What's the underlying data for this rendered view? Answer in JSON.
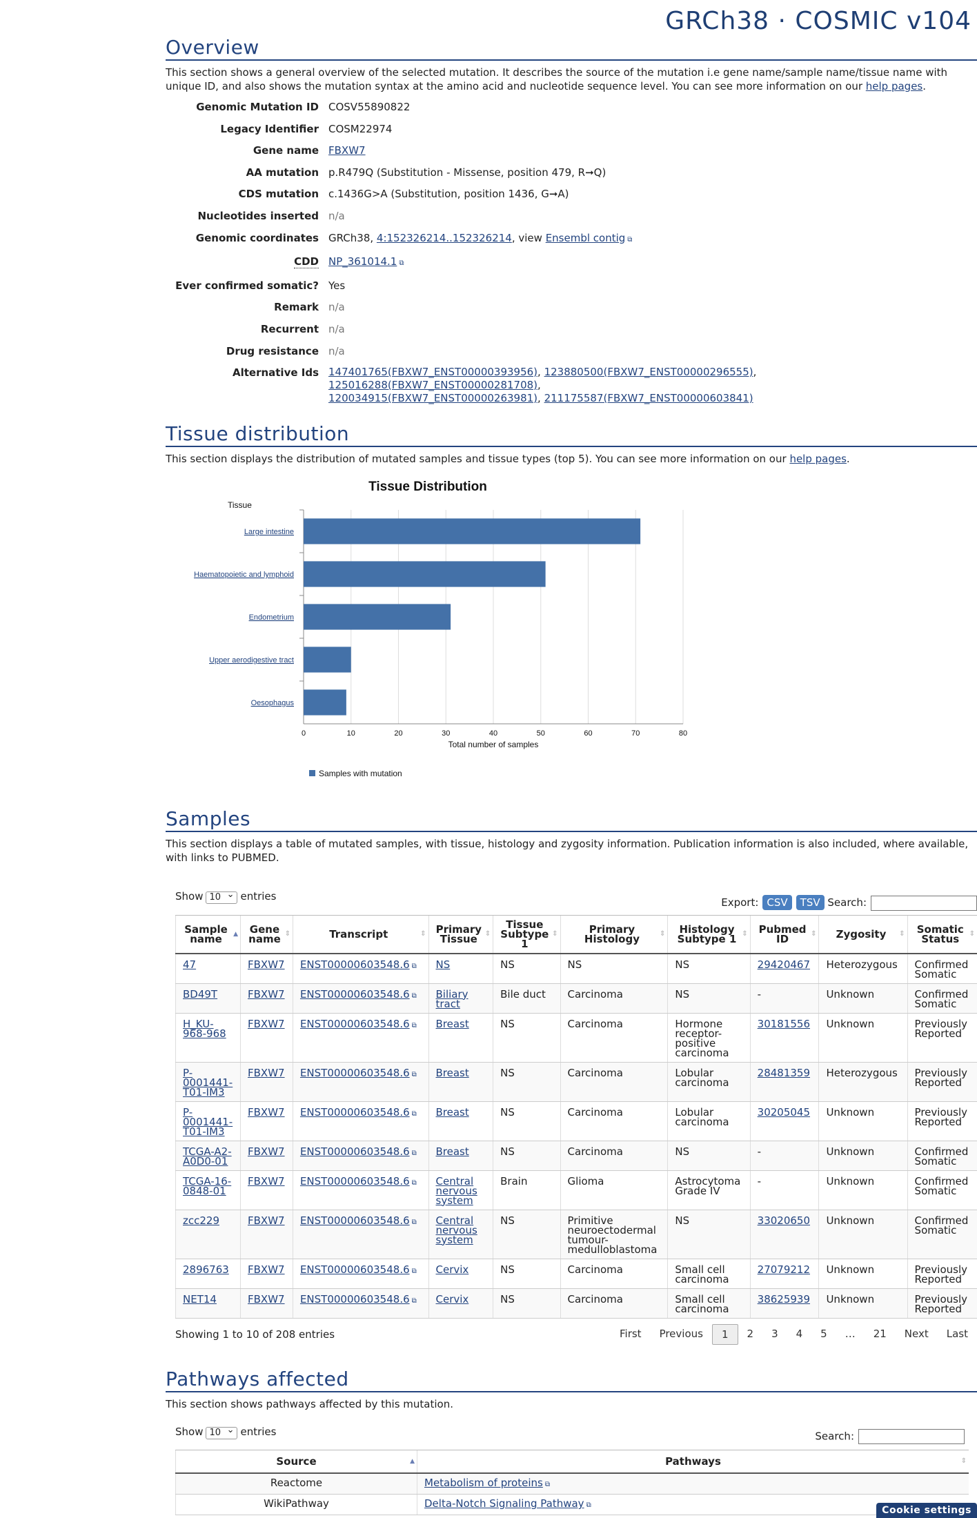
{
  "brand": "GRCh38 · COSMIC v104",
  "overview": {
    "title": "Overview",
    "description": "This section shows a general overview of the selected mutation. It describes the source of the mutation i.e gene name/sample name/tissue name with unique ID, and also shows the mutation syntax at the amino acid and nucleotide sequence level. You can see more information on our ",
    "help_link": "help pages",
    "rows": {
      "genomic_mutation_id": {
        "label": "Genomic Mutation ID",
        "value": "COSV55890822"
      },
      "legacy_identifier": {
        "label": "Legacy Identifier",
        "value": "COSM22974"
      },
      "gene_name": {
        "label": "Gene name",
        "value": "FBXW7"
      },
      "aa_mutation": {
        "label": "AA mutation",
        "value": "p.R479Q (Substitution - Missense, position 479, R➞Q)"
      },
      "cds_mutation": {
        "label": "CDS mutation",
        "value": "c.1436G>A (Substitution, position 1436, G➞A)"
      },
      "nucleotides_inserted": {
        "label": "Nucleotides inserted",
        "value": "n/a"
      },
      "genomic_coordinates": {
        "label": "Genomic coordinates",
        "prefix": "GRCh38, ",
        "link": "4:152326214..152326214",
        "mid": ", view ",
        "link2": "Ensembl contig"
      },
      "cdd": {
        "label": "CDD",
        "value": "NP_361014.1"
      },
      "ever_confirmed": {
        "label": "Ever confirmed somatic?",
        "value": "Yes"
      },
      "remark": {
        "label": "Remark",
        "value": "n/a"
      },
      "recurrent": {
        "label": "Recurrent",
        "value": "n/a"
      },
      "drug_resistance": {
        "label": "Drug resistance",
        "value": "n/a"
      },
      "alternative_ids": {
        "label": "Alternative Ids",
        "ids": [
          "147401765(FBXW7_ENST00000393956)",
          "123880500(FBXW7_ENST00000296555)",
          "125016288(FBXW7_ENST00000281708)",
          "120034915(FBXW7_ENST00000263981)",
          "211175587(FBXW7_ENST00000603841)"
        ]
      }
    }
  },
  "tissue": {
    "title": "Tissue distribution",
    "description": "This section displays the distribution of mutated samples and tissue types (top 5). You can see more information on our ",
    "help_link": "help pages"
  },
  "chart_data": {
    "type": "bar",
    "orientation": "horizontal",
    "title": "Tissue Distribution",
    "ylabel": "Tissue",
    "xlabel": "Total number of samples",
    "categories": [
      "Large intestine",
      "Haematopoietic and lymphoid",
      "Endometrium",
      "Upper aerodigestive tract",
      "Oesophagus"
    ],
    "values": [
      71,
      51,
      31,
      10,
      9
    ],
    "xlim": [
      0,
      80
    ],
    "xticks": [
      0,
      10,
      20,
      30,
      40,
      50,
      60,
      70,
      80
    ],
    "grid": true,
    "legend": "Samples with mutation",
    "legend_position": "bottom-left",
    "color": "#4471a8"
  },
  "samples": {
    "title": "Samples",
    "description": "This section displays a table of mutated samples, with tissue, histology and zygosity information. Publication information is also included, where available, with links to PUBMED.",
    "show": "Show",
    "entries": "entries",
    "page_size": "10",
    "export": "Export:",
    "csv": "CSV",
    "tsv": "TSV",
    "search": "Search:",
    "columns": [
      "Sample name",
      "Gene name",
      "Transcript",
      "Primary Tissue",
      "Tissue Subtype 1",
      "Primary Histology",
      "Histology Subtype 1",
      "Pubmed ID",
      "Zygosity",
      "Somatic Status"
    ],
    "rows": [
      [
        "47",
        "FBXW7",
        "ENST00000603548.6",
        "NS",
        "NS",
        "NS",
        "NS",
        "29420467",
        "Heterozygous",
        "Confirmed Somatic"
      ],
      [
        "BD49T",
        "FBXW7",
        "ENST00000603548.6",
        "Biliary tract",
        "Bile duct",
        "Carcinoma",
        "NS",
        "-",
        "Unknown",
        "Confirmed Somatic"
      ],
      [
        "H_KU-968-968",
        "FBXW7",
        "ENST00000603548.6",
        "Breast",
        "NS",
        "Carcinoma",
        "Hormone receptor-positive carcinoma",
        "30181556",
        "Unknown",
        "Previously Reported"
      ],
      [
        "P-0001441-T01-IM3",
        "FBXW7",
        "ENST00000603548.6",
        "Breast",
        "NS",
        "Carcinoma",
        "Lobular carcinoma",
        "28481359",
        "Heterozygous",
        "Previously Reported"
      ],
      [
        "P-0001441-T01-IM3",
        "FBXW7",
        "ENST00000603548.6",
        "Breast",
        "NS",
        "Carcinoma",
        "Lobular carcinoma",
        "30205045",
        "Unknown",
        "Previously Reported"
      ],
      [
        "TCGA-A2-A0D0-01",
        "FBXW7",
        "ENST00000603548.6",
        "Breast",
        "NS",
        "Carcinoma",
        "NS",
        "-",
        "Unknown",
        "Confirmed Somatic"
      ],
      [
        "TCGA-16-0848-01",
        "FBXW7",
        "ENST00000603548.6",
        "Central nervous system",
        "Brain",
        "Glioma",
        "Astrocytoma Grade IV",
        "-",
        "Unknown",
        "Confirmed Somatic"
      ],
      [
        "zcc229",
        "FBXW7",
        "ENST00000603548.6",
        "Central nervous system",
        "NS",
        "Primitive neuroectodermal tumour-medulloblastoma",
        "NS",
        "33020650",
        "Unknown",
        "Confirmed Somatic"
      ],
      [
        "2896763",
        "FBXW7",
        "ENST00000603548.6",
        "Cervix",
        "NS",
        "Carcinoma",
        "Small cell carcinoma",
        "27079212",
        "Unknown",
        "Previously Reported"
      ],
      [
        "NET14",
        "FBXW7",
        "ENST00000603548.6",
        "Cervix",
        "NS",
        "Carcinoma",
        "Small cell carcinoma",
        "38625939",
        "Unknown",
        "Previously Reported"
      ]
    ],
    "info": "Showing 1 to 10 of 208 entries",
    "pager": {
      "first": "First",
      "previous": "Previous",
      "pages": [
        "1",
        "2",
        "3",
        "4",
        "5",
        "…",
        "21"
      ],
      "next": "Next",
      "last": "Last"
    }
  },
  "pathways": {
    "title": "Pathways affected",
    "description": "This section shows pathways affected by this mutation.",
    "show": "Show",
    "entries": "entries",
    "page_size": "10",
    "search": "Search:",
    "columns": [
      "Source",
      "Pathways"
    ],
    "rows": [
      {
        "source": "Reactome",
        "pathway": "Metabolism of proteins"
      },
      {
        "source": "WikiPathway",
        "pathway": "Delta-Notch Signaling Pathway"
      }
    ]
  },
  "cookie": "Cookie settings"
}
